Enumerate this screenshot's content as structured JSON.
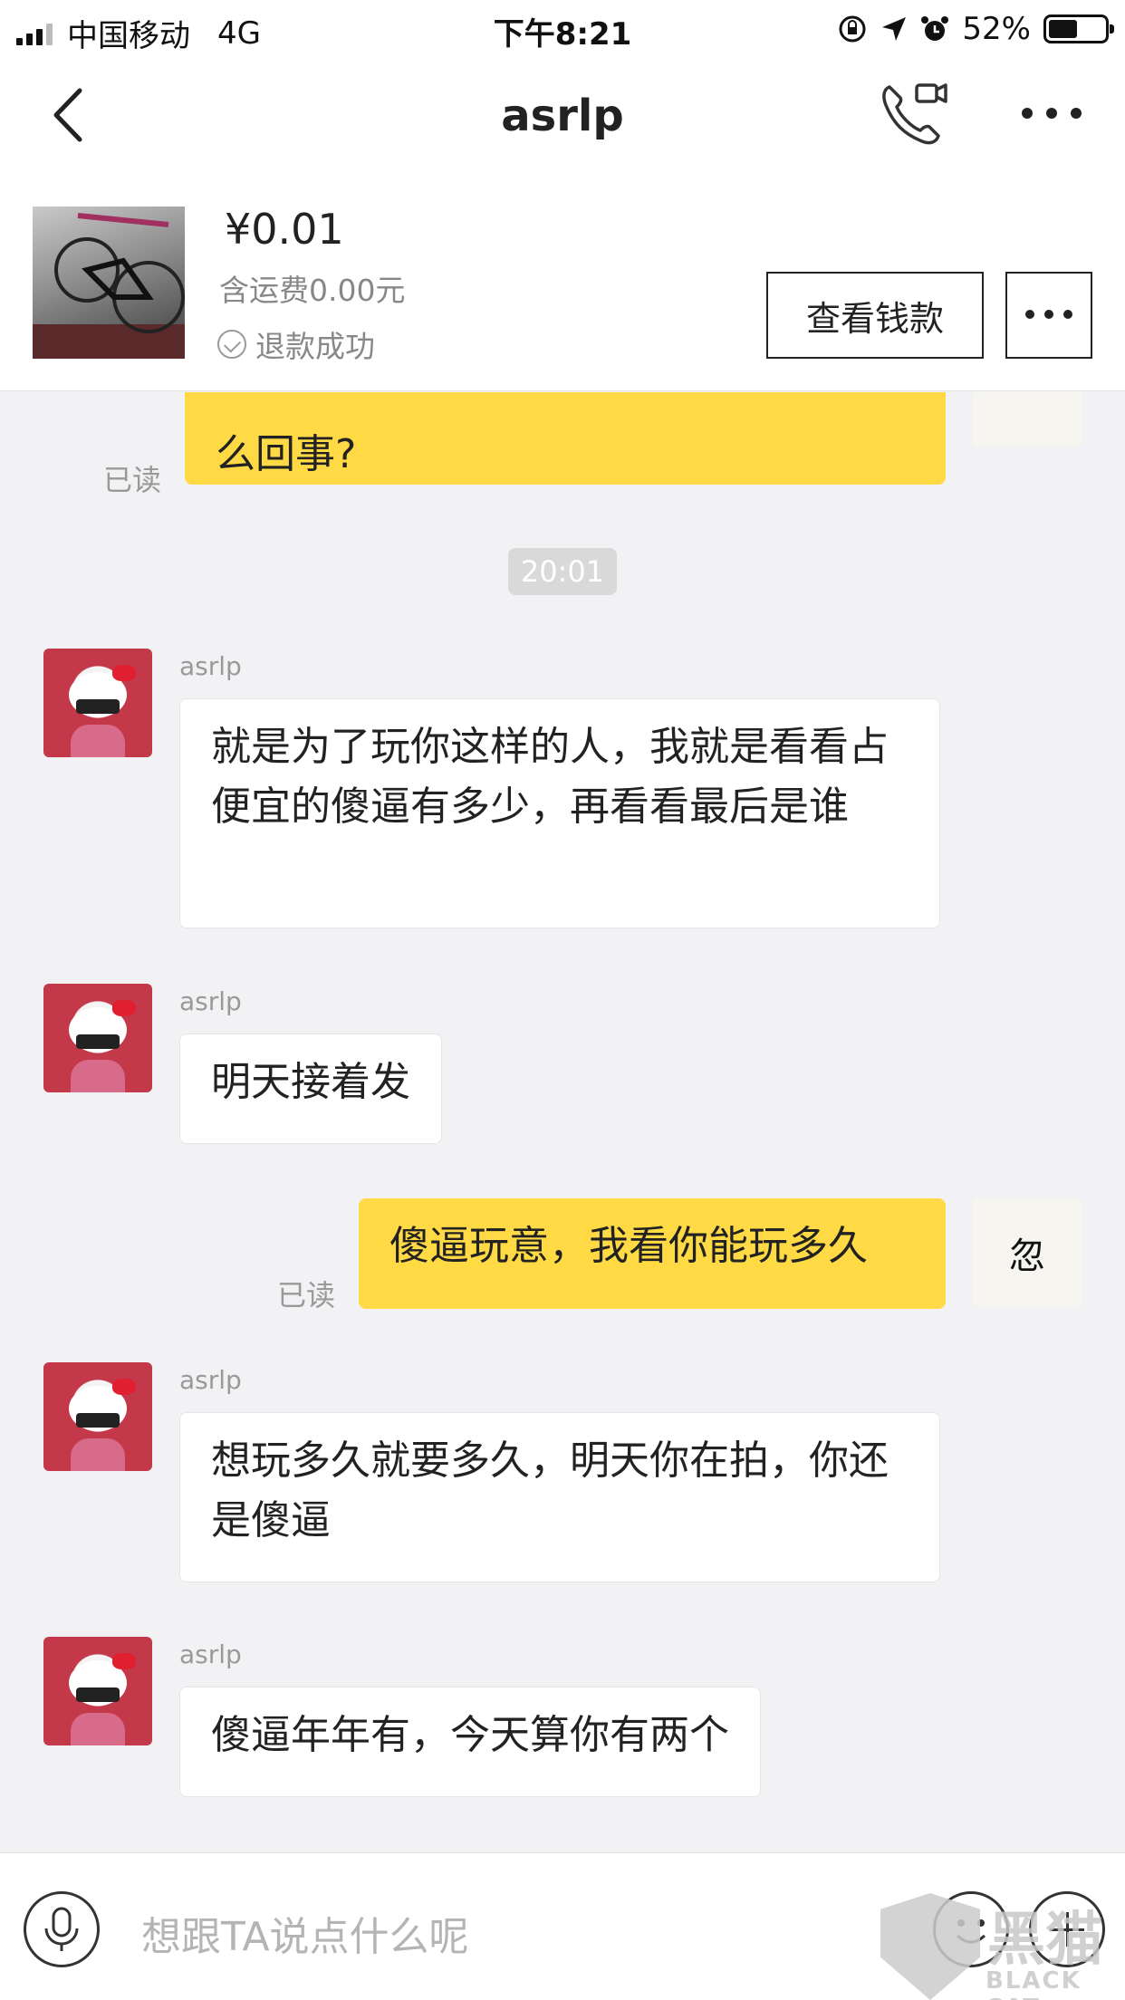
{
  "status_bar": {
    "carrier": "中国移动",
    "network": "4G",
    "time": "下午8:21",
    "battery_percent": "52%",
    "battery_level": 0.52
  },
  "header": {
    "title": "asrlp",
    "back_icon": "chevron-left-icon",
    "call_icon": "phone-video-icon",
    "more_icon": "more-icon"
  },
  "product": {
    "price": "¥0.01",
    "shipping": "含运费0.00元",
    "status": "退款成功",
    "view_payment_label": "查看钱款"
  },
  "chat": {
    "top_partial_text": "么回事?",
    "top_read_label": "已读",
    "timestamp": "20:01",
    "messages": [
      {
        "sender": "asrlp",
        "text": "就是为了玩你这样的人，我就是看看占便宜的傻逼有多少，再看看最后是谁"
      },
      {
        "sender": "asrlp",
        "text": "明天接着发"
      },
      {
        "sender": "me",
        "text": "傻逼玩意，我看你能玩多久",
        "read": "已读",
        "avatar_char": "忽"
      },
      {
        "sender": "asrlp",
        "text": "想玩多久就要多久，明天你在拍，你还是傻逼"
      },
      {
        "sender": "asrlp",
        "text": "傻逼年年有，今天算你有两个"
      }
    ]
  },
  "input": {
    "placeholder": "想跟TA说点什么呢"
  },
  "watermark": {
    "cn": "黑猫",
    "en": "BLACK CAT"
  },
  "colors": {
    "bubble_out": "#ffda44",
    "bubble_in": "#ffffff",
    "chat_bg": "#f2f2f5"
  }
}
